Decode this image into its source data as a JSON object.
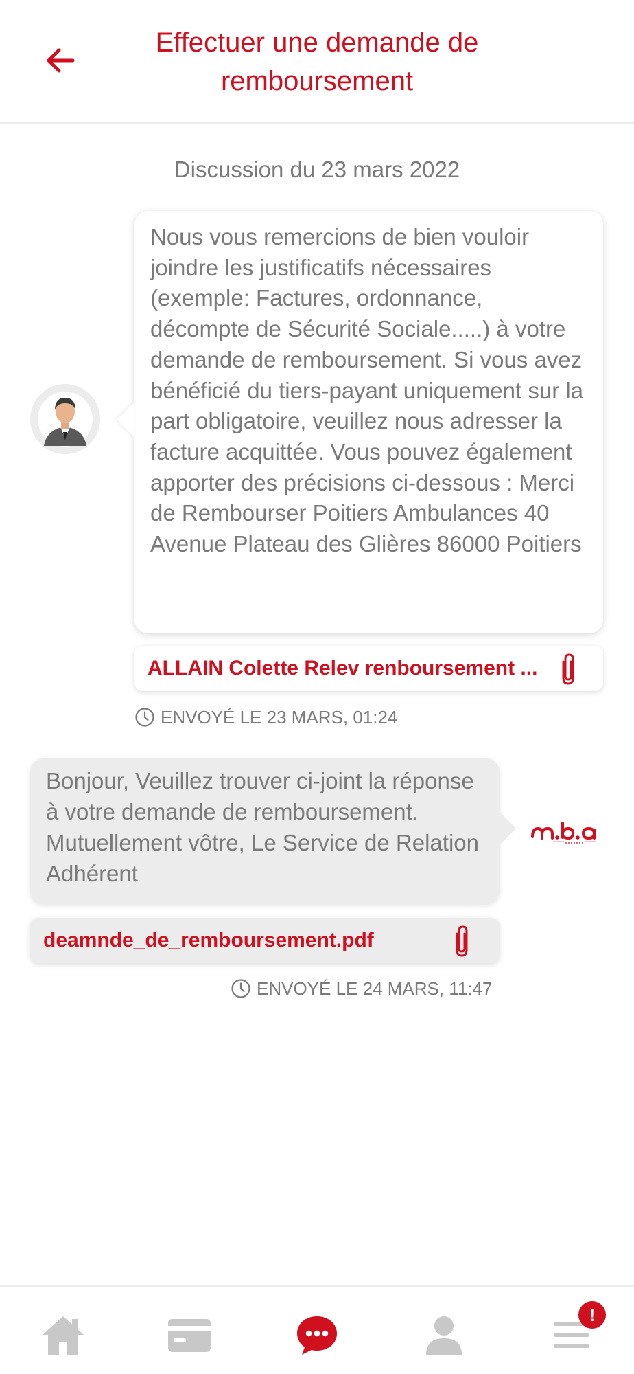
{
  "header": {
    "title": "Effectuer une demande de remboursement",
    "back_icon": "arrow-left-icon"
  },
  "discussion": {
    "date_label": "Discussion du 23 mars 2022"
  },
  "messages": [
    {
      "direction": "incoming",
      "avatar_icon": "user-avatar-icon",
      "text": "Nous vous remercions de bien vouloir joindre les justificatifs nécessaires (exemple: Factures, ordonnance, décompte de Sécurité Sociale.....) à votre demande de remboursement. Si vous avez bénéficié du tiers-payant uniquement sur la part obligatoire, veuillez nous adresser la facture acquittée. Vous pouvez également apporter des précisions ci-dessous : Merci de Rembourser Poitiers Ambulances 40 Avenue Plateau des Glières 86000 Poitiers",
      "attachment": "ALLAIN Colette Relev renboursement ...",
      "sent_label": "ENVOYÉ LE 23 MARS, 01:24"
    },
    {
      "direction": "outgoing",
      "logo_icon": "mba-mutuelle-logo",
      "text": "Bonjour, Veuillez trouver ci-joint la réponse à votre demande de remboursement. Mutuellement vôtre, Le Service de Relation Adhérent",
      "attachment": "deamnde_de_remboursement.pdf",
      "sent_label": "ENVOYÉ LE 24 MARS, 11:47"
    }
  ],
  "bottom_nav": {
    "items": [
      {
        "icon": "home-icon",
        "active": false
      },
      {
        "icon": "card-icon",
        "active": false
      },
      {
        "icon": "chat-icon",
        "active": true
      },
      {
        "icon": "profile-icon",
        "active": false
      },
      {
        "icon": "menu-icon",
        "active": false
      }
    ],
    "menu_badge": "!"
  },
  "colors": {
    "accent": "#d0101e",
    "text_grey": "#7a7a7a",
    "bubble_grey": "#ececec",
    "nav_inactive": "#c8c8c8"
  }
}
